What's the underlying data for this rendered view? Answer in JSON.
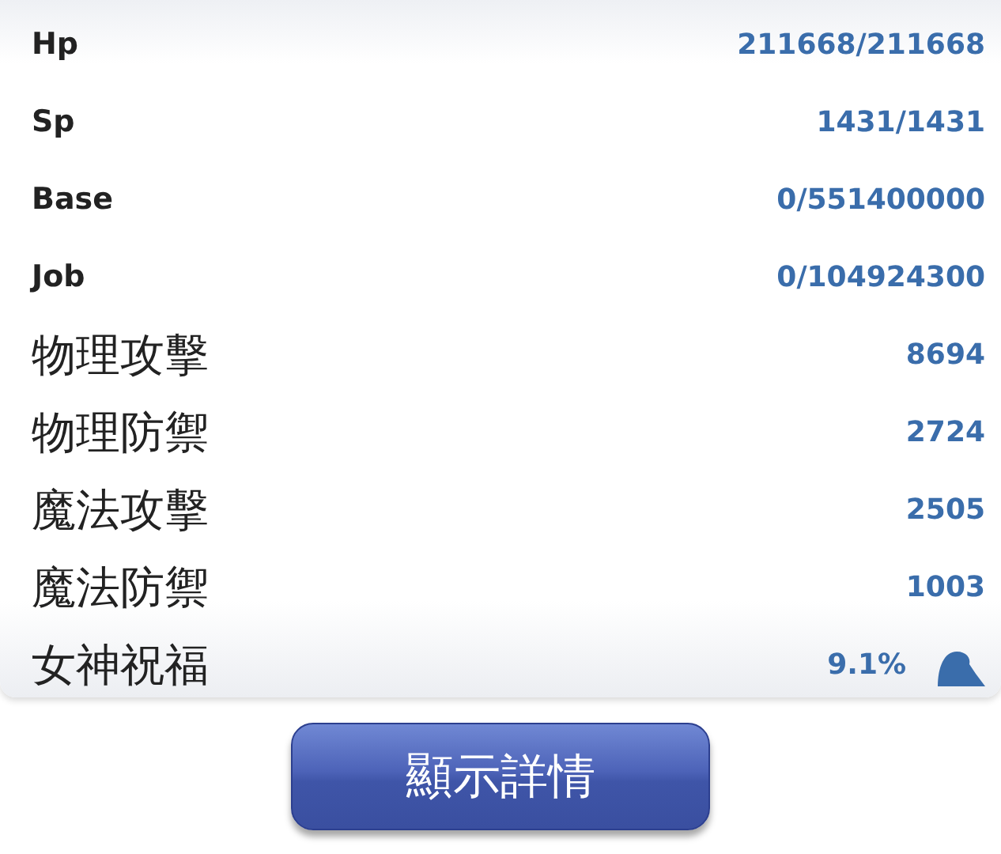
{
  "stats": [
    {
      "kind": "code",
      "label": "Hp",
      "value": "211668/211668"
    },
    {
      "kind": "code",
      "label": "Sp",
      "value": "1431/1431"
    },
    {
      "kind": "code",
      "label": "Base",
      "value": "0/551400000"
    },
    {
      "kind": "code",
      "label": "Job",
      "value": "0/104924300"
    },
    {
      "kind": "name",
      "label": "物理攻擊",
      "value": "8694"
    },
    {
      "kind": "name",
      "label": "物理防禦",
      "value": "2724"
    },
    {
      "kind": "name",
      "label": "魔法攻擊",
      "value": "2505"
    },
    {
      "kind": "name",
      "label": "魔法防禦",
      "value": "1003"
    },
    {
      "kind": "blessing",
      "label": "女神祝福",
      "value": "9.1%"
    }
  ],
  "button": {
    "label": "顯示詳情"
  }
}
